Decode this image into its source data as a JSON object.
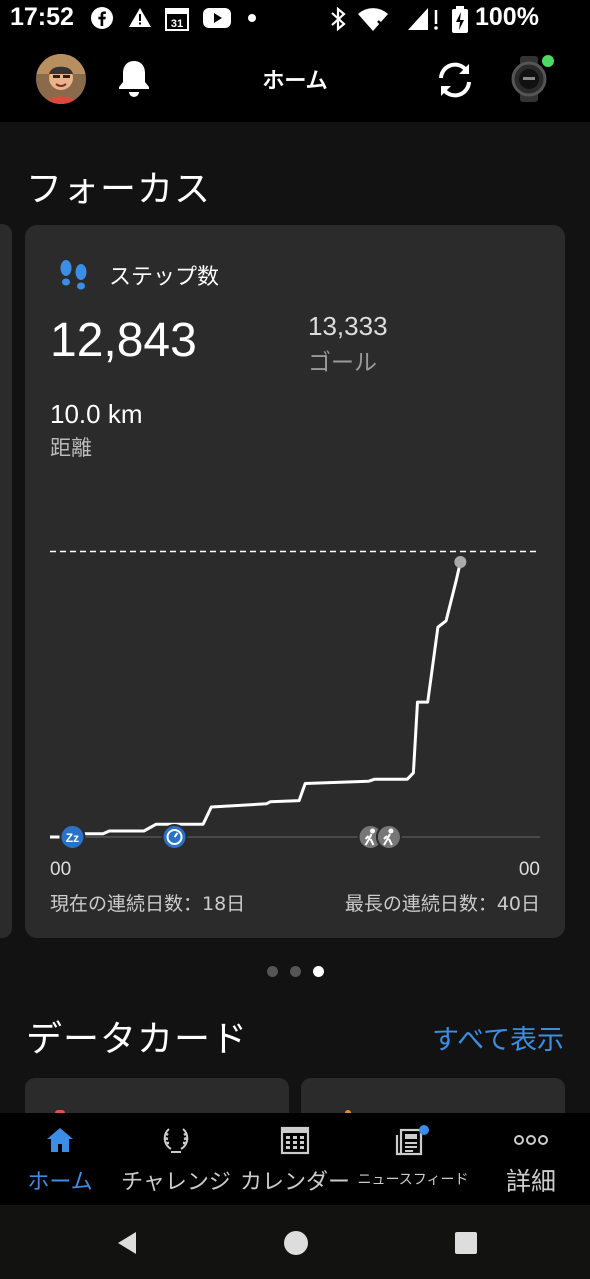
{
  "status_bar": {
    "time": "17:52",
    "battery": "100%",
    "calendar_day": "31",
    "icons": [
      "facebook-icon",
      "warning-icon",
      "calendar-icon",
      "youtube-icon",
      "dot-icon",
      "bluetooth-icon",
      "wifi-icon",
      "signal-icon",
      "battery-charging-icon"
    ]
  },
  "header": {
    "title": "ホーム",
    "icons": [
      "avatar",
      "bell-icon",
      "sync-icon",
      "watch-icon"
    ],
    "watch_status_color": "#4cd964"
  },
  "focus": {
    "section_title": "フォーカス",
    "card": {
      "title": "ステップ数",
      "steps": "12,843",
      "goal_value": "13,333",
      "goal_label": "ゴール",
      "distance_value": "10.0 km",
      "distance_label": "距離",
      "x_start_label": "00",
      "x_end_label": "00",
      "current_streak": "現在の連続日数：18日",
      "longest_streak": "最長の連続日数：40日"
    },
    "carousel": {
      "count": 3,
      "active_index": 2
    }
  },
  "chart_data": {
    "type": "line",
    "title": "",
    "xlabel": "",
    "ylabel": "",
    "x_unit": "hour of day",
    "xlim": [
      0,
      24
    ],
    "ylim": [
      0,
      14200
    ],
    "goal": 13333,
    "series": [
      {
        "values_xy": [
          [
            0,
            0
          ],
          [
            0.8,
            0
          ],
          [
            1.6,
            150
          ],
          [
            2.6,
            150
          ],
          [
            2.9,
            280
          ],
          [
            4.6,
            280
          ],
          [
            5.2,
            600
          ],
          [
            7.5,
            600
          ],
          [
            7.9,
            1400
          ],
          [
            10.6,
            1550
          ],
          [
            10.8,
            1650
          ],
          [
            12.2,
            1700
          ],
          [
            12.5,
            2500
          ],
          [
            15.6,
            2600
          ],
          [
            15.9,
            2700
          ],
          [
            17.5,
            2700
          ],
          [
            17.8,
            3000
          ],
          [
            18.0,
            6300
          ],
          [
            18.5,
            6300
          ],
          [
            19.0,
            9800
          ],
          [
            19.4,
            10100
          ],
          [
            19.9,
            12000
          ],
          [
            20.1,
            12843
          ]
        ]
      }
    ],
    "markers": [
      {
        "x": 1.1,
        "icon": "sleep-icon",
        "color": "#2a72c8"
      },
      {
        "x": 6.1,
        "icon": "timer-icon",
        "color": "#2a72c8"
      },
      {
        "x": 15.7,
        "icon": "walk-icon",
        "color": "#777777"
      },
      {
        "x": 16.6,
        "icon": "walk-icon",
        "color": "#777777"
      }
    ],
    "line_color": "#ffffff",
    "goal_line_color": "#ffffff"
  },
  "data_cards": {
    "section_title": "データカード",
    "view_all": "すべて表示",
    "left_accent": "#e0534a",
    "right_accent": "#e8912d"
  },
  "bottom_nav": {
    "items": [
      {
        "label": "ホーム",
        "icon": "home-icon",
        "active": true
      },
      {
        "label": "チャレンジ",
        "icon": "laurel-icon",
        "active": false
      },
      {
        "label": "カレンダー",
        "icon": "calendar-grid-icon",
        "active": false
      },
      {
        "label": "ニュースフィード",
        "icon": "newsfeed-icon",
        "active": false
      },
      {
        "label": "詳細",
        "icon": "more-icon",
        "active": false
      }
    ],
    "active_color": "#3b8ee5",
    "badge_color": "#3b8ee5"
  },
  "system_nav": {
    "icons": [
      "back-icon",
      "home-circle-icon",
      "recents-icon"
    ]
  }
}
